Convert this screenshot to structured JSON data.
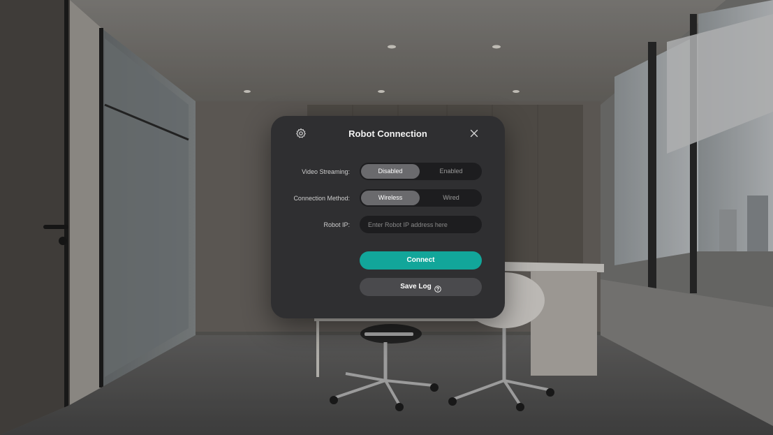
{
  "dialog": {
    "title": "Robot Connection",
    "settings_icon": "gear-icon",
    "close_icon": "close-icon"
  },
  "video_streaming": {
    "label": "Video Streaming:",
    "options": [
      "Disabled",
      "Enabled"
    ],
    "selected": "Disabled"
  },
  "connection_method": {
    "label": "Connection Method:",
    "options": [
      "Wireless",
      "Wired"
    ],
    "selected": "Wireless"
  },
  "robot_ip": {
    "label": "Robot IP:",
    "placeholder": "Enter Robot IP address here",
    "value": ""
  },
  "buttons": {
    "connect": "Connect",
    "save_log": "Save Log",
    "save_log_icon": "help-circle-icon"
  },
  "colors": {
    "accent": "#12a69a",
    "dialog_bg": "#2f2f31",
    "segment_bg": "#1d1d1f",
    "segment_active": "#6a6a6d"
  }
}
